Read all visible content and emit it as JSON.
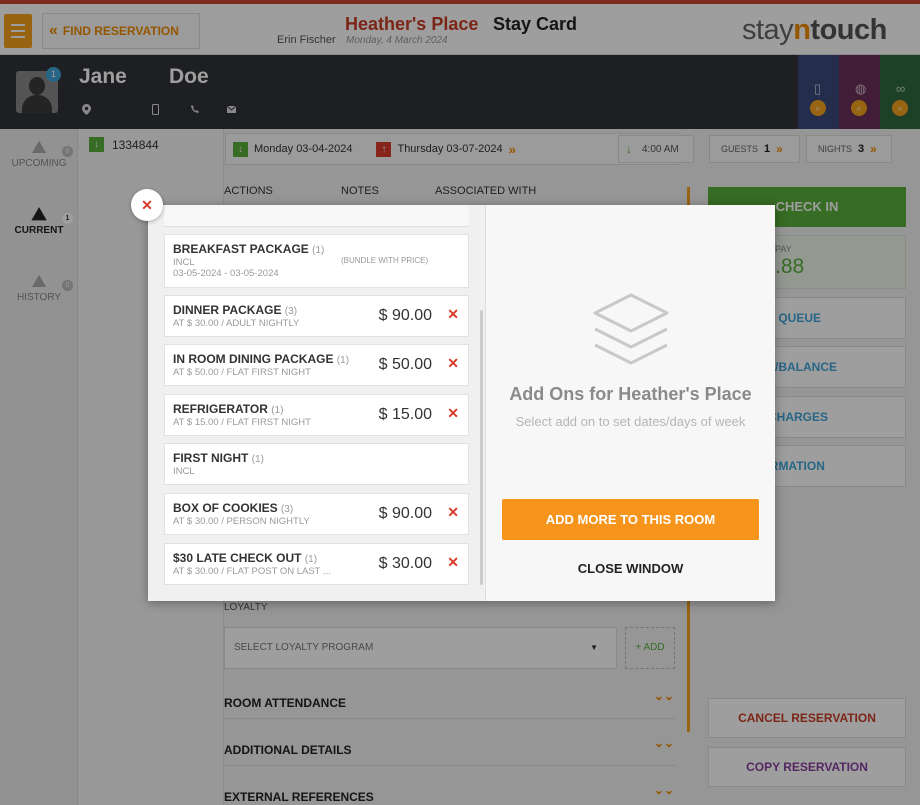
{
  "header": {
    "find_reservation": "FIND RESERVATION",
    "hotel_name": "Heather's Place",
    "page_title": "Stay Card",
    "user_name": "Erin Fischer",
    "date": "Monday, 4 March 2024",
    "logo_pre": "stay",
    "logo_n": "n",
    "logo_post": "touch",
    "accent_color": "#c73c24",
    "brand_color": "#f08c00"
  },
  "guest": {
    "first_name": "Jane",
    "last_name": "Doe",
    "avatar_badge": "1",
    "icons": [
      "location-icon",
      "mobile-icon",
      "phone-icon",
      "email-icon"
    ]
  },
  "sidebar": {
    "items": [
      {
        "label": "UPCOMING",
        "count": "0"
      },
      {
        "label": "CURRENT",
        "count": "1"
      },
      {
        "label": "HISTORY",
        "count": "0"
      }
    ],
    "confirmation": "1334844"
  },
  "reservation": {
    "arrival": "Monday 03-04-2024",
    "departure": "Thursday 03-07-2024",
    "time": "4:00 AM",
    "guests_label": "GUESTS",
    "guests": "1",
    "nights_label": "NIGHTS",
    "nights": "3",
    "tabs": [
      "ACTIONS",
      "NOTES",
      "ASSOCIATED WITH"
    ],
    "check_in": "CHECK IN",
    "pay_label": "PAY",
    "pay_amount": ".88",
    "right_buttons": [
      "IN QUEUE",
      "OSIT/BALANCE",
      "& CHARGES",
      "FIRMATION"
    ],
    "loyalty_label": "LOYALTY",
    "loyalty_placeholder": "SELECT LOYALTY PROGRAM",
    "loyalty_add": "+ ADD",
    "sections": [
      "ROOM ATTENDANCE",
      "ADDITIONAL DETAILS",
      "EXTERNAL REFERENCES"
    ],
    "cancel": "CANCEL RESERVATION",
    "copy": "COPY RESERVATION"
  },
  "modal": {
    "addons": [
      {
        "name": "BREAKFAST PACKAGE",
        "qty": "(1)",
        "sub": "INCL",
        "dates": "03-05-2024 - 03-05-2024",
        "bundle": "(BUNDLE WITH PRICE)",
        "price": "",
        "removable": false
      },
      {
        "name": "DINNER PACKAGE",
        "qty": "(3)",
        "sub": "AT $ 30.00 / ADULT NIGHTLY",
        "price": "$ 90.00",
        "removable": true
      },
      {
        "name": "IN ROOM DINING PACKAGE",
        "qty": "(1)",
        "sub": "AT $ 50.00 / FLAT FIRST NIGHT",
        "price": "$ 50.00",
        "removable": true
      },
      {
        "name": "REFRIGERATOR",
        "qty": "(1)",
        "sub": "AT $ 15.00 / FLAT FIRST NIGHT",
        "price": "$ 15.00",
        "removable": true
      },
      {
        "name": "FIRST NIGHT",
        "qty": "(1)",
        "sub": "INCL",
        "price": "",
        "removable": false
      },
      {
        "name": "BOX OF COOKIES",
        "qty": "(3)",
        "sub": "AT $ 30.00 / PERSON NIGHTLY",
        "price": "$ 90.00",
        "removable": true
      },
      {
        "name": "$30 LATE CHECK OUT",
        "qty": "(1)",
        "sub": "AT $ 30.00 / FLAT POST ON LAST ...",
        "price": "$ 30.00",
        "removable": true
      }
    ],
    "title": "Add Ons for Heather's Place",
    "subtitle": "Select add on to set dates/days of week",
    "add_more": "ADD MORE TO THIS ROOM",
    "close_window": "CLOSE WINDOW"
  }
}
